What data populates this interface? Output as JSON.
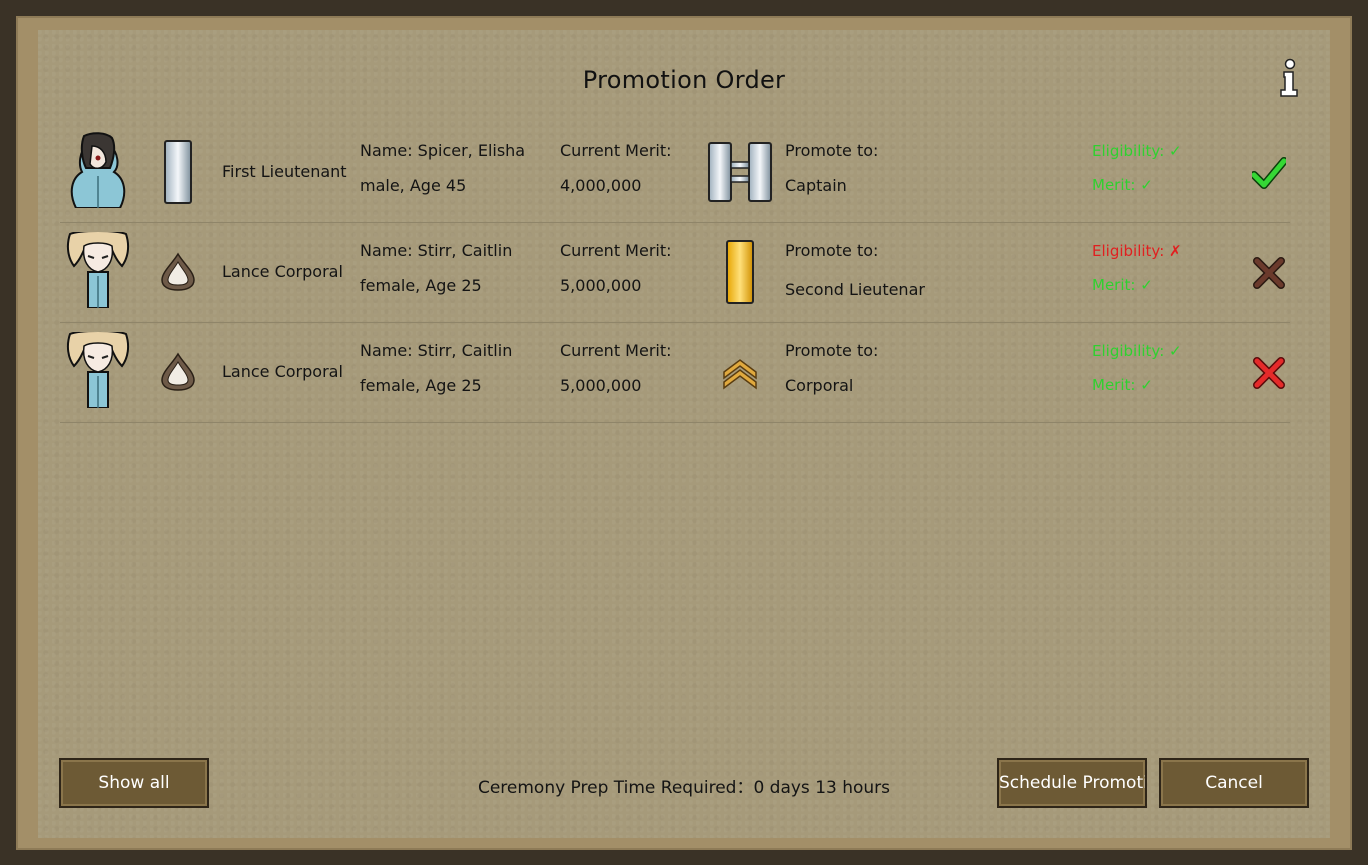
{
  "title": "Promotion Order",
  "rows": [
    {
      "current_rank": "First Lieutenant",
      "name": "Name: Spicer, Elisha",
      "details": "male, Age 45",
      "merit_label": "Current Merit:",
      "merit_value": "4,000,000",
      "promote_label": "Promote to:",
      "promote_rank": "Captain",
      "eligibility": "Eligibility: ✓",
      "merit_status": "Merit: ✓",
      "eligibility_ok": true,
      "merit_ok": true,
      "action": "approve"
    },
    {
      "current_rank": "Lance Corporal",
      "name": "Name: Stirr, Caitlin",
      "details": "female, Age 25",
      "merit_label": "Current Merit:",
      "merit_value": "5,000,000",
      "promote_label": "Promote to:",
      "promote_rank": "Second Lieutenar",
      "eligibility": "Eligibility: ✗",
      "merit_status": "Merit: ✓",
      "eligibility_ok": false,
      "merit_ok": true,
      "action": "reject-disabled"
    },
    {
      "current_rank": "Lance Corporal",
      "name": "Name: Stirr, Caitlin",
      "details": "female, Age 25",
      "merit_label": "Current Merit:",
      "merit_value": "5,000,000",
      "promote_label": "Promote to:",
      "promote_rank": "Corporal",
      "eligibility": "Eligibility: ✓",
      "merit_status": "Merit: ✓",
      "eligibility_ok": true,
      "merit_ok": true,
      "action": "reject"
    }
  ],
  "footer": {
    "show_all": "Show all",
    "prep_time": "Ceremony Prep Time Required：0 days 13 hours",
    "schedule": "Schedule Promoti",
    "cancel": "Cancel"
  },
  "colors": {
    "ok": "#2fd12f",
    "fail": "#e02020",
    "button": "#6d5a35"
  },
  "icons": {
    "info": "info-icon",
    "approve": "checkmark-icon",
    "reject": "x-icon"
  }
}
